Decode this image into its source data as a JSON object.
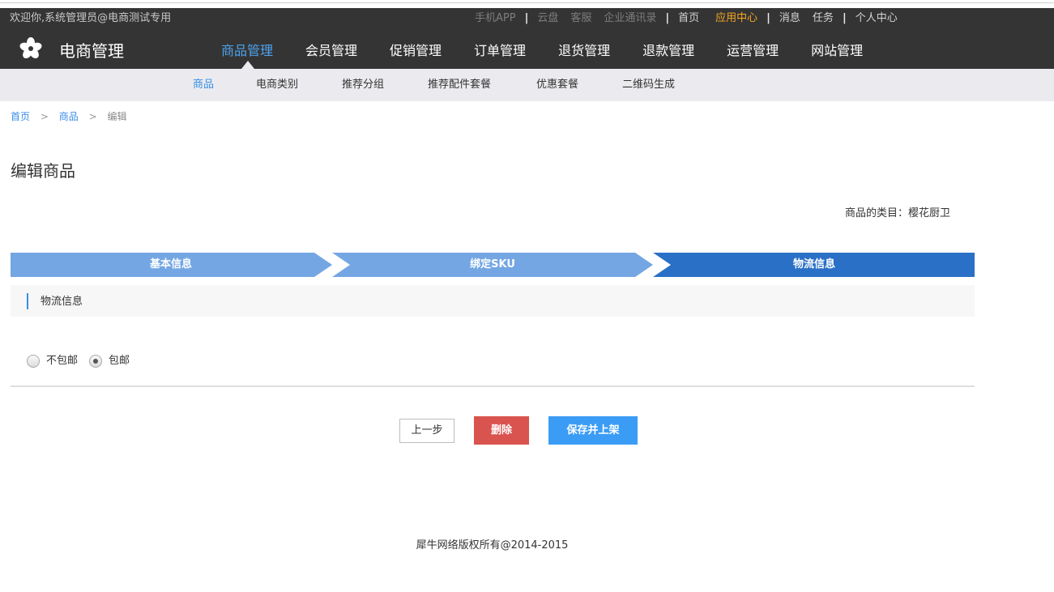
{
  "header": {
    "welcome": "欢迎你,系统管理员@电商测试专用",
    "top_links": {
      "app": "手机APP",
      "cloud": "云盘",
      "service": "客服",
      "contacts": "企业通讯录",
      "home": "首页",
      "app_center": "应用中心",
      "messages": "消息",
      "tasks": "任务",
      "personal": "个人中心"
    },
    "brand": "电商管理",
    "main_nav": [
      "商品管理",
      "会员管理",
      "促销管理",
      "订单管理",
      "退货管理",
      "退款管理",
      "运营管理",
      "网站管理"
    ],
    "main_nav_active": "商品管理"
  },
  "subnav": {
    "items": [
      "商品",
      "电商类别",
      "推荐分组",
      "推荐配件套餐",
      "优惠套餐",
      "二维码生成"
    ],
    "active": "商品"
  },
  "breadcrumb": {
    "home": "首页",
    "arrow": ">",
    "product": "商品",
    "current": "编辑"
  },
  "page": {
    "title": "编辑商品",
    "category_label": "商品的类目：樱花厨卫"
  },
  "steps": {
    "items": [
      "基本信息",
      "绑定SKU",
      "物流信息"
    ],
    "active_index": 2,
    "colors": {
      "inactive": "#74a6e3",
      "active": "#2a70c6"
    }
  },
  "section": {
    "title": "物流信息"
  },
  "shipping": {
    "options": [
      "不包邮",
      "包邮"
    ],
    "selected": "包邮"
  },
  "buttons": {
    "prev": "上一步",
    "delete": "删除",
    "save": "保存并上架"
  },
  "footer": {
    "copyright": "犀牛网络版权所有@2014-2015"
  }
}
